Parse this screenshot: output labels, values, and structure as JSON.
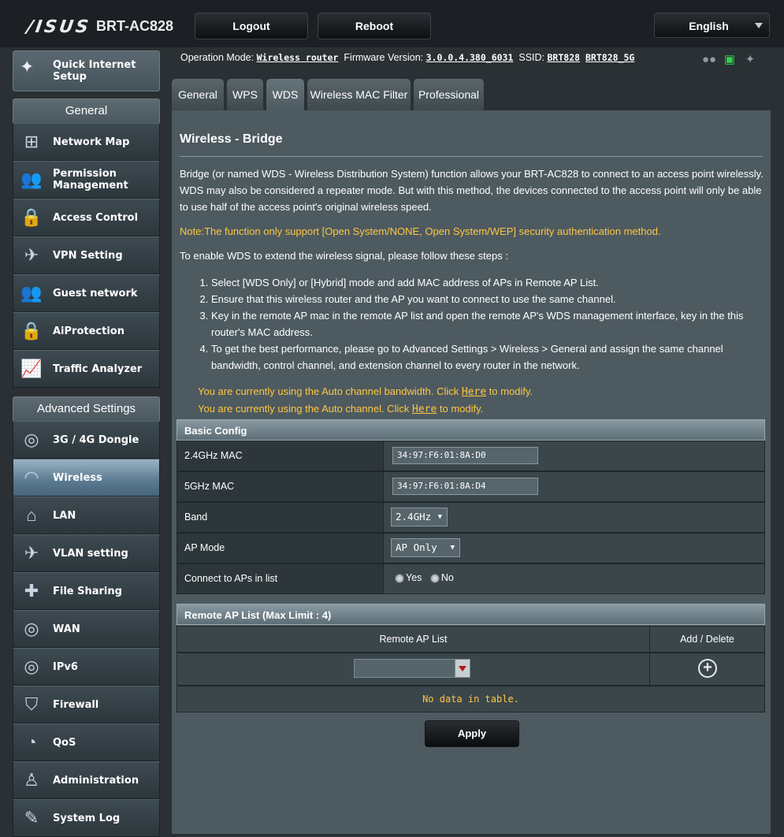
{
  "header": {
    "brand": "/ISUS",
    "model": "BRT-AC828",
    "logout_label": "Logout",
    "reboot_label": "Reboot",
    "language": "English"
  },
  "sidebar": {
    "quick_setup": "Quick Internet Setup",
    "general_title": "General",
    "general_items": [
      {
        "label": "Network Map",
        "icon": "network-map-icon"
      },
      {
        "label": "Permission Management",
        "icon": "users-icon"
      },
      {
        "label": "Access Control",
        "icon": "lock-icon"
      },
      {
        "label": "VPN Setting",
        "icon": "vpn-icon"
      },
      {
        "label": "Guest network",
        "icon": "guest-icon"
      },
      {
        "label": "AiProtection",
        "icon": "aiprotection-icon"
      },
      {
        "label": "Traffic Analyzer",
        "icon": "traffic-icon"
      }
    ],
    "advanced_title": "Advanced Settings",
    "advanced_items": [
      {
        "label": "3G / 4G Dongle",
        "icon": "globe-icon"
      },
      {
        "label": "Wireless",
        "icon": "wifi-icon"
      },
      {
        "label": "LAN",
        "icon": "home-icon"
      },
      {
        "label": "VLAN setting",
        "icon": "vlan-icon"
      },
      {
        "label": "File Sharing",
        "icon": "puzzle-icon"
      },
      {
        "label": "WAN",
        "icon": "globe-icon"
      },
      {
        "label": "IPv6",
        "icon": "ipv6-icon"
      },
      {
        "label": "Firewall",
        "icon": "shield-icon"
      },
      {
        "label": "QoS",
        "icon": "gauge-icon"
      },
      {
        "label": "Administration",
        "icon": "person-icon"
      },
      {
        "label": "System Log",
        "icon": "log-icon"
      }
    ]
  },
  "opbar": {
    "mode_label": "Operation Mode:",
    "mode_value": "Wireless router",
    "fw_label": "Firmware Version:",
    "fw_value": "3.0.0.4.380_6031",
    "ssid_label": "SSID:",
    "ssid_1": "BRT828",
    "ssid_2": "BRT828_5G"
  },
  "tabs": [
    "General",
    "WPS",
    "WDS",
    "Wireless MAC Filter",
    "Professional"
  ],
  "content": {
    "title": "Wireless - Bridge",
    "intro": "Bridge (or named WDS - Wireless Distribution System) function allows your BRT-AC828 to connect to an access point wirelessly. WDS may also be considered a repeater mode. But with this method, the devices connected to the access point will only be able to use half of the access point's original wireless speed.",
    "note": "Note:The function only support [Open System/NONE, Open System/WEP] security authentication method.",
    "steps_intro": "To enable WDS to extend the wireless signal, please follow these steps :",
    "steps": [
      "Select [WDS Only] or [Hybrid] mode and add MAC address of APs in Remote AP List.",
      "Ensure that this wireless router and the AP you want to connect to use the same channel.",
      "Key in the remote AP mac in the remote AP list and open the remote AP's WDS management interface, key in the this router's MAC address.",
      "To get the best performance, please go to Advanced Settings > Wireless > General and assign the same channel bandwidth, control channel, and extension channel to every router in the network."
    ],
    "bw_pre": "You are currently using the Auto channel bandwidth. Click ",
    "bw_link": "Here",
    "bw_post": " to modify.",
    "ch_pre": "You are currently using the Auto channel. Click ",
    "ch_link": "Here",
    "ch_post": " to modify."
  },
  "basic_config": {
    "title": "Basic Config",
    "mac24_label": "2.4GHz MAC",
    "mac24_value": "34:97:F6:01:8A:D0",
    "mac5_label": "5GHz MAC",
    "mac5_value": "34:97:F6:01:8A:D4",
    "band_label": "Band",
    "band_value": "2.4GHz",
    "apmode_label": "AP Mode",
    "apmode_value": "AP Only",
    "connect_label": "Connect to APs in list",
    "yes": "Yes",
    "no": "No"
  },
  "remote_ap": {
    "title": "Remote AP List (Max Limit : 4)",
    "col1": "Remote AP List",
    "col2": "Add / Delete",
    "empty": "No data in table."
  },
  "apply_label": "Apply"
}
